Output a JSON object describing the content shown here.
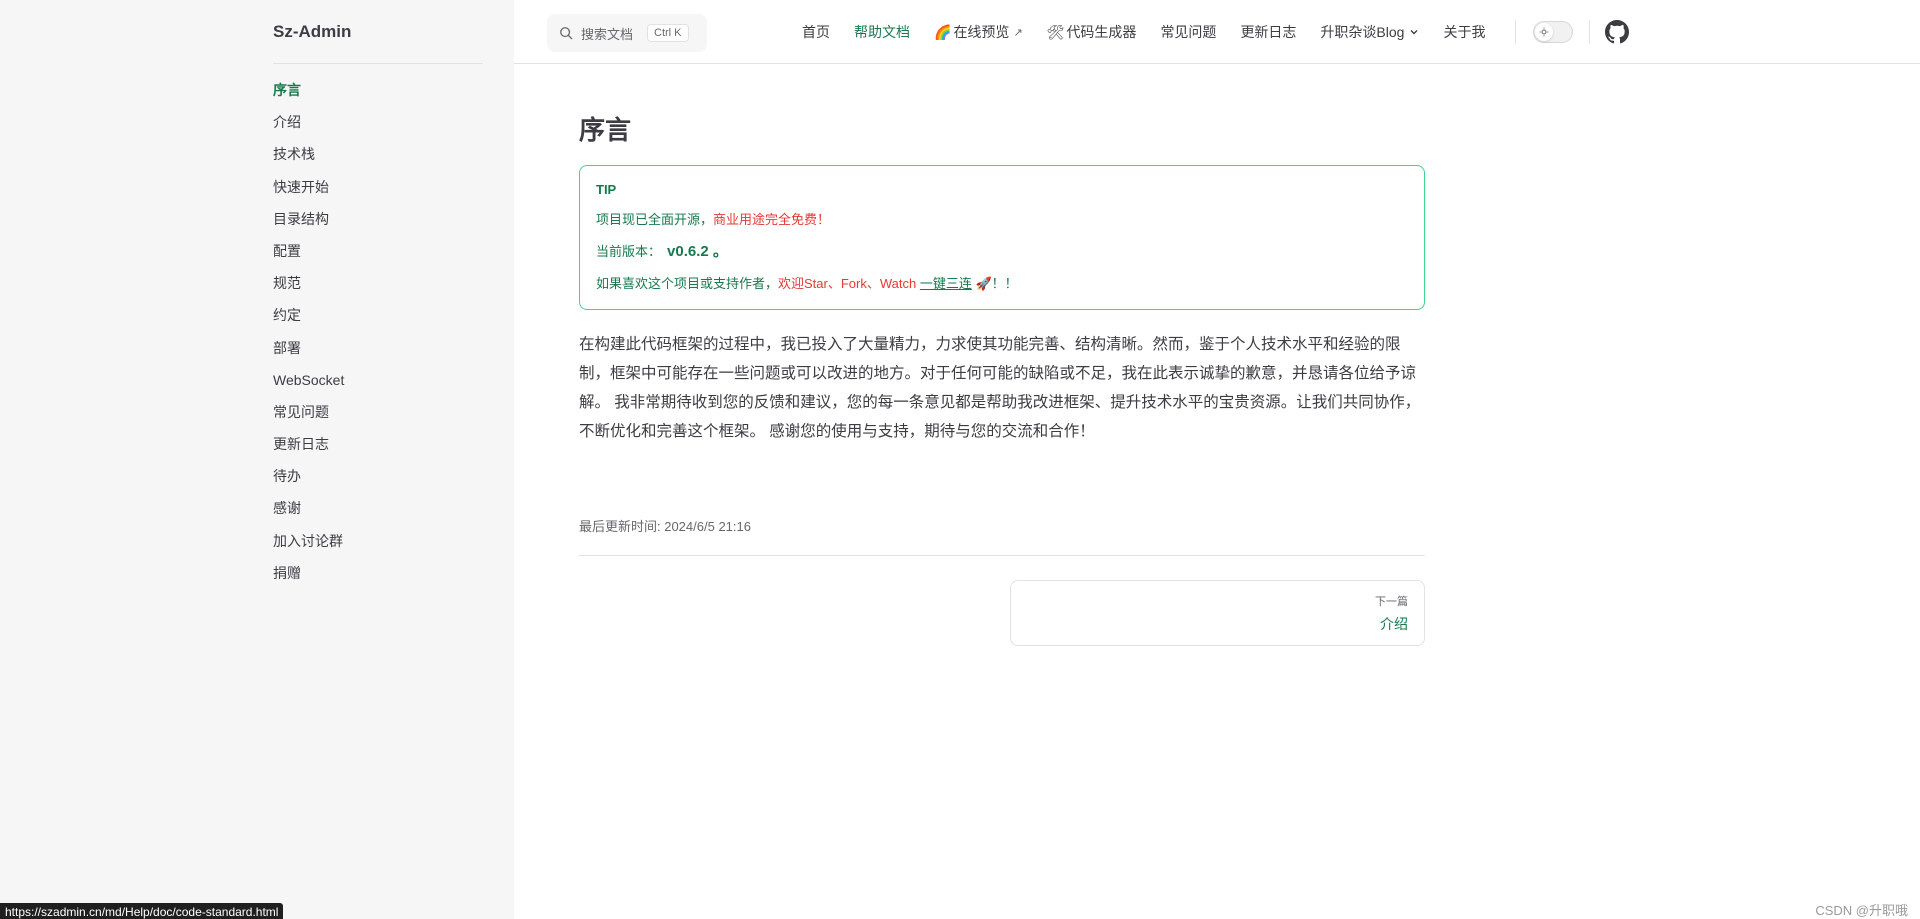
{
  "colors": {
    "brand": "#18794e",
    "tip_border": "#3dd68c",
    "emphasis": "#e53935",
    "sidebar_bg": "#f6f6f7"
  },
  "site": {
    "title": "Sz-Admin"
  },
  "sidebar": {
    "items": [
      {
        "label": "序言",
        "active": true
      },
      {
        "label": "介绍"
      },
      {
        "label": "技术栈"
      },
      {
        "label": "快速开始"
      },
      {
        "label": "目录结构"
      },
      {
        "label": "配置"
      },
      {
        "label": "规范"
      },
      {
        "label": "约定"
      },
      {
        "label": "部署"
      },
      {
        "label": "WebSocket"
      },
      {
        "label": "常见问题"
      },
      {
        "label": "更新日志"
      },
      {
        "label": "待办"
      },
      {
        "label": "感谢"
      },
      {
        "label": "加入讨论群"
      },
      {
        "label": "捐赠"
      }
    ]
  },
  "search": {
    "placeholder": "搜索文档",
    "shortcut": "Ctrl K",
    "icon": "search-icon"
  },
  "nav": {
    "home": "首页",
    "docs": "帮助文档",
    "preview_emoji": "🌈",
    "preview": "在线预览",
    "preview_arrow": "↗",
    "codegen_emoji": "🛠",
    "codegen": "代码生成器",
    "faq": "常见问题",
    "changelog": "更新日志",
    "blog": "升职杂谈Blog",
    "about": "关于我"
  },
  "page": {
    "title": "序言",
    "tip": {
      "title": "TIP",
      "line1_prefix": "项目现已全面开源，",
      "line1_emphasis": "商业用途完全免费",
      "line1_suffix": "！",
      "line2_prefix": "当前版本：",
      "version": "v0.6.2 。",
      "line3_prefix": "如果喜欢这个项目或支持作者，",
      "line3_emphasis": "欢迎Star、Fork、Watch",
      "line3_link": "一键三连",
      "line3_emoji": "🚀",
      "line3_suffix": "！！"
    },
    "paragraph": "在构建此代码框架的过程中，我已投入了大量精力，力求使其功能完善、结构清晰。然而，鉴于个人技术水平和经验的限制，框架中可能存在一些问题或可以改进的地方。对于任何可能的缺陷或不足，我在此表示诚挚的歉意，并恳请各位给予谅解。 我非常期待收到您的反馈和建议，您的每一条意见都是帮助我改进框架、提升技术水平的宝贵资源。让我们共同协作，不断优化和完善这个框架。 感谢您的使用与支持，期待与您的交流和合作！",
    "last_updated": "最后更新时间: 2024/6/5 21:16",
    "next": {
      "label": "下一篇",
      "title": "介绍"
    }
  },
  "status_bar": {
    "url": "https://szadmin.cn/md/Help/doc/code-standard.html"
  },
  "watermark": "CSDN @升职哦"
}
